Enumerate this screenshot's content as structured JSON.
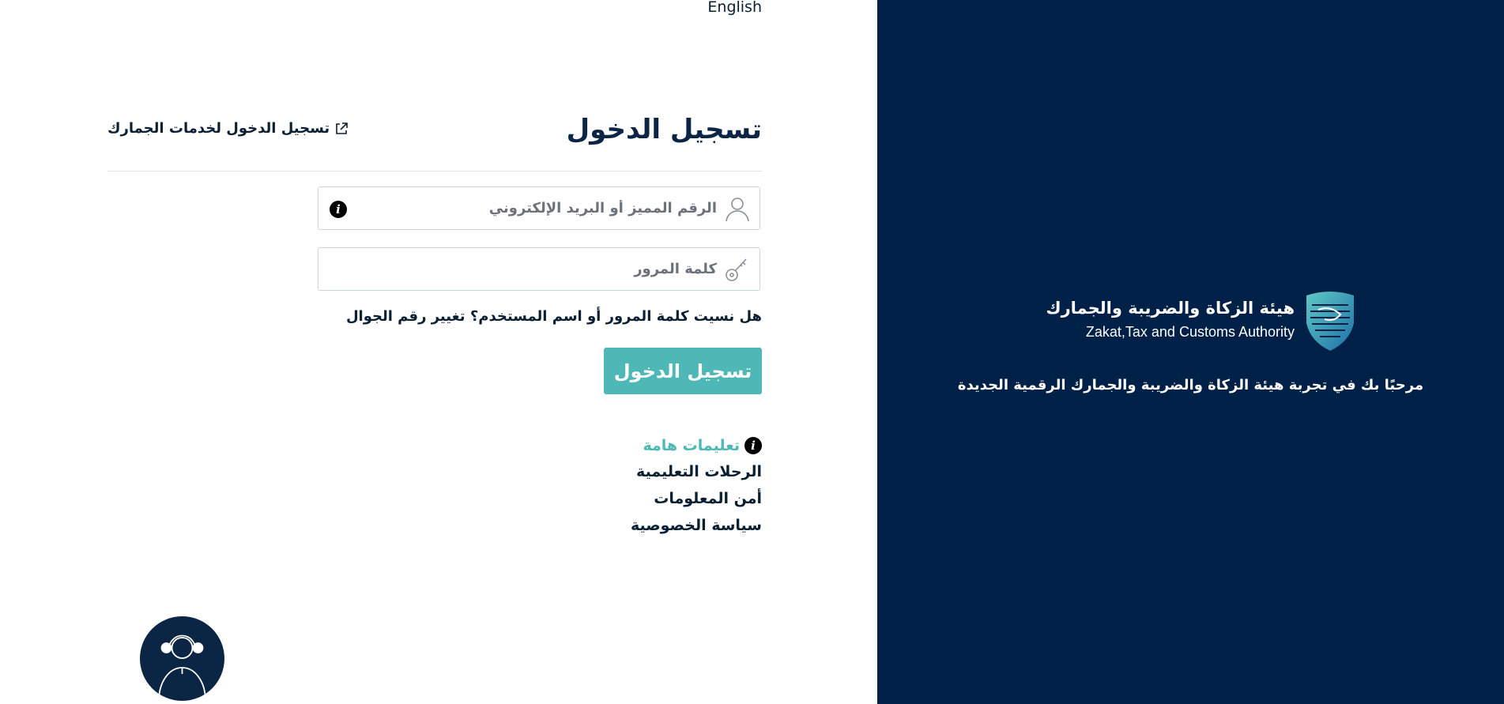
{
  "language_toggle": {
    "label": "English"
  },
  "header": {
    "title": "تسجيل الدخول",
    "customs_link_label": "تسجيل الدخول لخدمات الجمارك"
  },
  "form": {
    "username": {
      "placeholder": "الرقم المميز أو البريد الإلكتروني",
      "value": ""
    },
    "password": {
      "placeholder": "كلمة المرور",
      "value": ""
    },
    "forgot_prompt": "هل نسيت كلمة المرور أو اسم المستخدم؟",
    "change_mobile_label": "تغيير رقم الجوال",
    "submit_label": "تسجيل الدخول"
  },
  "links": {
    "important_instructions": "تعليمات هامة",
    "tutorial_journeys": "الرحلات التعليمية",
    "information_security": "أمن المعلومات",
    "privacy_policy": "سياسة الخصوصية"
  },
  "icons": {
    "username": "user-icon",
    "password": "key-icon",
    "info": "info-icon",
    "external": "external-link-icon",
    "support": "support-agent-icon",
    "logo": "zatca-logo-icon"
  },
  "brand": {
    "name_ar": "هيئة الزكاة والضريبة والجمارك",
    "name_en": "Zakat,Tax and Customs Authority",
    "welcome": "مرحبًا بك في تجربة هيئة الزكاة والضريبة والجمارك الرقمية الجديدة"
  },
  "colors": {
    "brand_navy": "#002147",
    "accent_teal": "#4db8b5",
    "title_navy": "#0b2545",
    "border_gray": "#cfd4da"
  }
}
